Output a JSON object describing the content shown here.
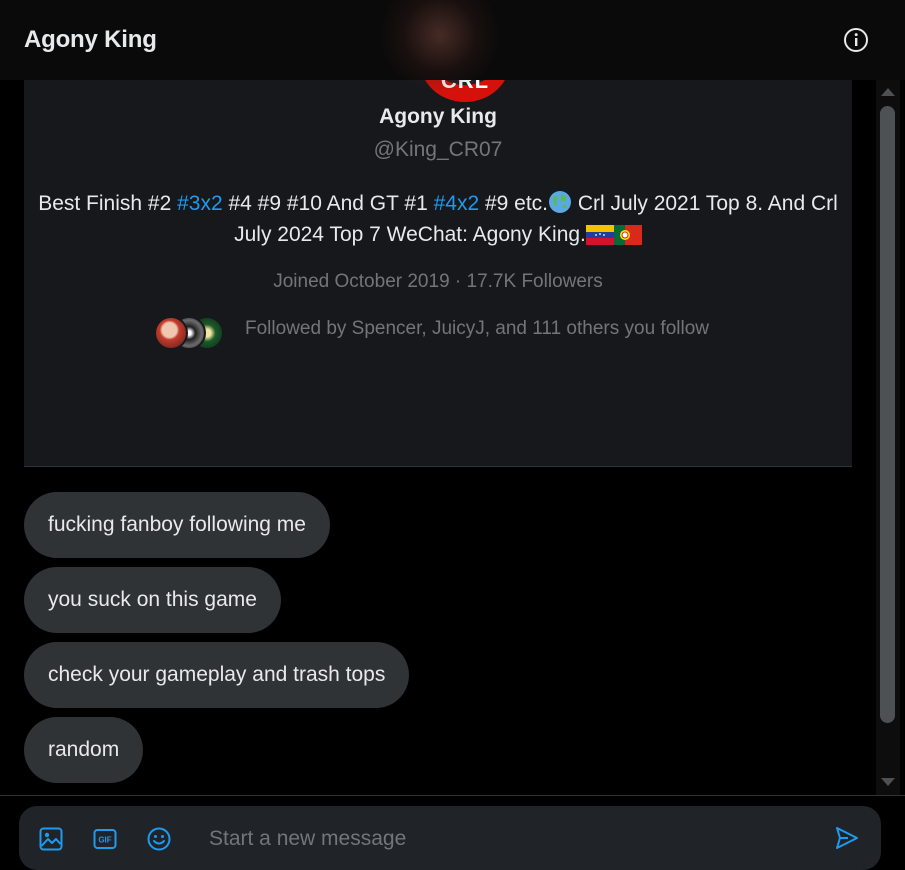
{
  "header": {
    "title": "Agony King",
    "info_icon": "info-circle-icon"
  },
  "profile": {
    "avatar_text": "CRL",
    "name": "Agony King",
    "handle": "@King_CR07",
    "bio": {
      "part1": "Best Finish #2 ",
      "tag1": "#3x2",
      "part2": " #4 #9 #10 And GT #1 ",
      "tag2": "#4x2",
      "part3": " #9 etc.",
      "part4": " Crl July 2021 Top 8. And Crl July 2024 Top 7 WeChat: Agony King.",
      "emoji_icons": [
        "globe-icon",
        "venezuela-flag-icon",
        "portugal-flag-icon"
      ]
    },
    "meta": "Joined October 2019 · 17.7K Followers",
    "followed_by": "Followed by Spencer, JuicyJ, and 111 others you follow"
  },
  "messages": [
    {
      "text": "fucking fanboy following me"
    },
    {
      "text": "you suck on this game"
    },
    {
      "text": "check your gameplay and trash tops"
    },
    {
      "text": "random"
    }
  ],
  "composer": {
    "placeholder": "Start a new message",
    "value": "",
    "icons": [
      "image-icon",
      "gif-icon",
      "emoji-icon",
      "send-icon"
    ]
  },
  "colors": {
    "accent": "#1d9bf0",
    "background": "#000000",
    "card": "#16181c",
    "bubble": "#2f3336",
    "muted_text": "#71767b"
  }
}
